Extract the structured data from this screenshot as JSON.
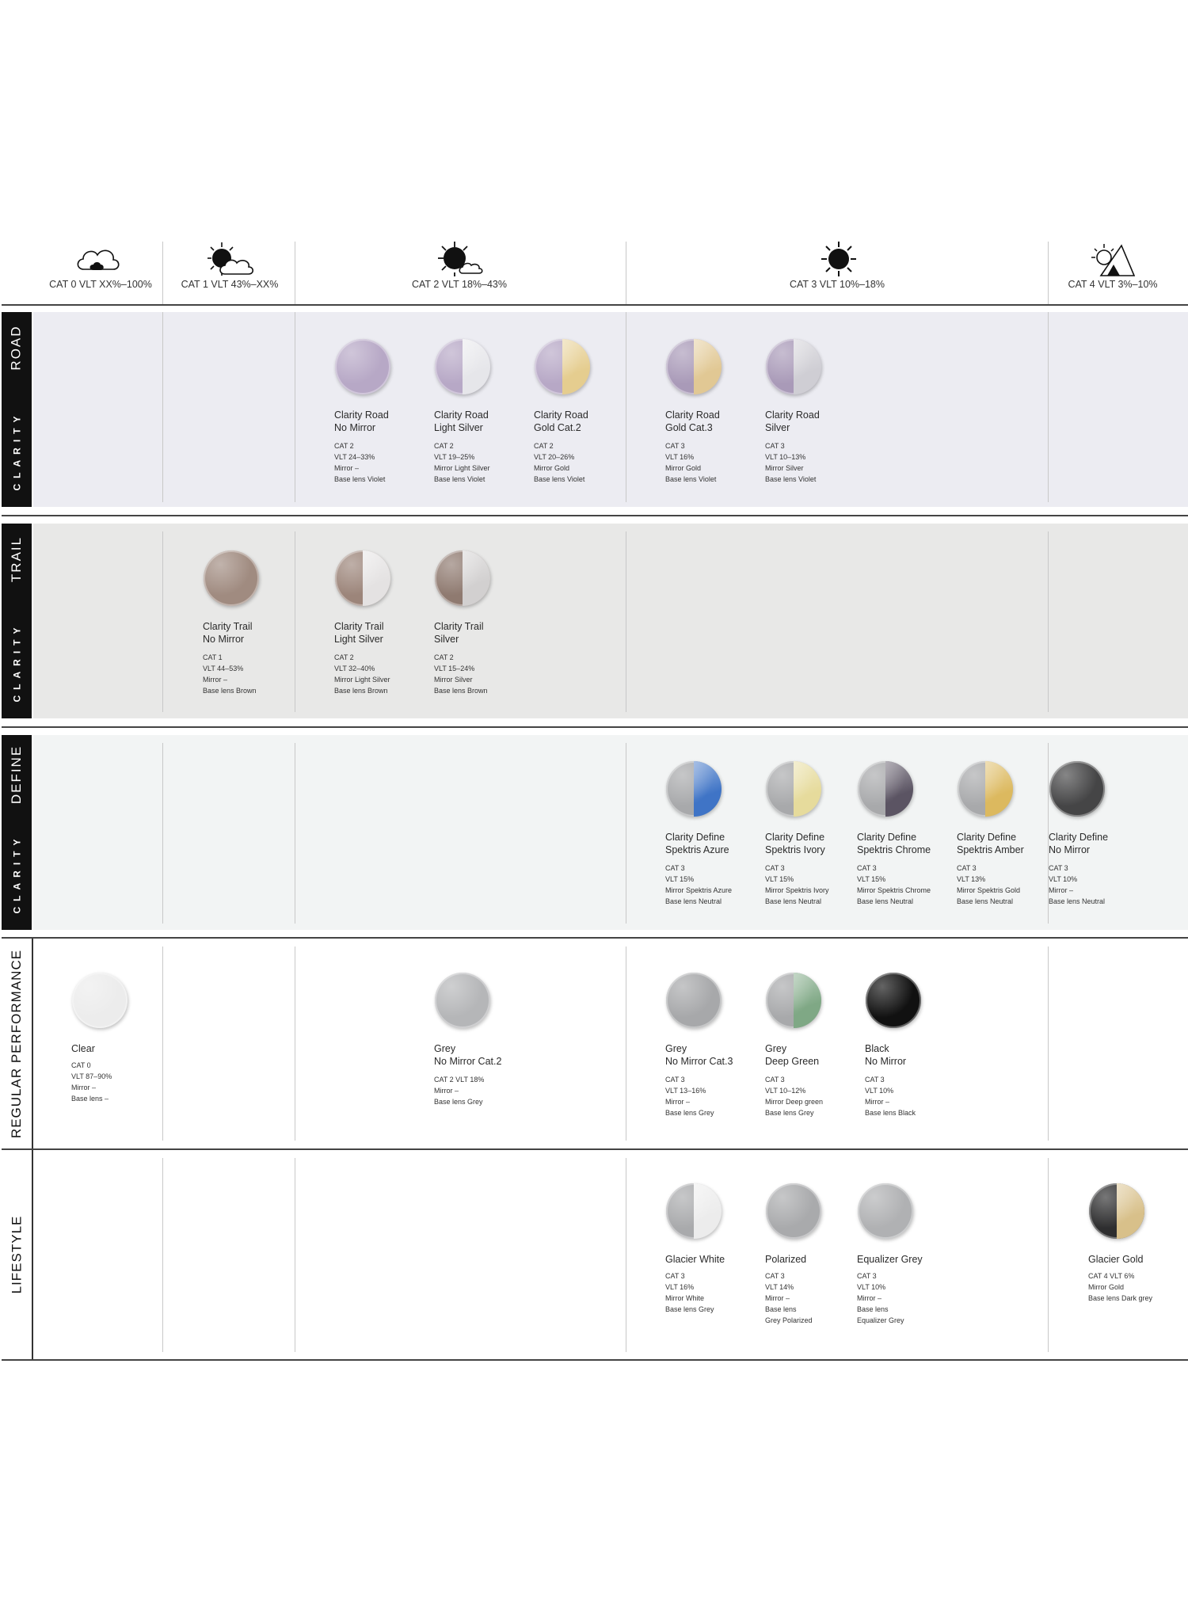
{
  "header": {
    "columns": [
      {
        "label": "CAT 0 VLT XX%–100%",
        "icon": "cloud-icon"
      },
      {
        "label": "CAT 1 VLT 43%–XX%",
        "icon": "sun-behind-cloud-icon"
      },
      {
        "label": "CAT 2 VLT 18%–43%",
        "icon": "partly-sunny-icon"
      },
      {
        "label": "CAT 3 VLT 10%–18%",
        "icon": "sun-icon"
      },
      {
        "label": "CAT 4 VLT 3%–10%",
        "icon": "mountain-sun-icon"
      }
    ]
  },
  "rows": {
    "clarity_road": {
      "label_top": "ROAD",
      "label_bottom": "CLARITY"
    },
    "clarity_trail": {
      "label_top": "TRAIL",
      "label_bottom": "CLARITY"
    },
    "clarity_define": {
      "label_top": "DEFINE",
      "label_bottom": "CLARITY"
    },
    "regular": {
      "label": "REGULAR PERFORMANCE"
    },
    "lifestyle": {
      "label": "LIFESTYLE"
    }
  },
  "lenses": [
    {
      "name1": "Clarity Road",
      "name2": "No Mirror",
      "specs": [
        "CAT 2",
        "VLT 24–33%",
        "Mirror –",
        "Base lens Violet"
      ],
      "base": "#b7a8c6",
      "mirror": "",
      "split": false
    },
    {
      "name1": "Clarity Road",
      "name2": "Light Silver",
      "specs": [
        "CAT 2",
        "VLT 19–25%",
        "Mirror Light Silver",
        "Base lens Violet"
      ],
      "base": "#b7a8c6",
      "mirror": "#e6e6ea",
      "split": true
    },
    {
      "name1": "Clarity Road",
      "name2": "Gold Cat.2",
      "specs": [
        "CAT 2",
        "VLT 20–26%",
        "Mirror Gold",
        "Base lens Violet"
      ],
      "base": "#b7a8c6",
      "mirror": "#e5cd8f",
      "split": true
    },
    {
      "name1": "Clarity Road",
      "name2": "Gold Cat.3",
      "specs": [
        "CAT 3",
        "VLT 16%",
        "Mirror Gold",
        "Base lens Violet"
      ],
      "base": "#a99ab8",
      "mirror": "#e1c894",
      "split": true
    },
    {
      "name1": "Clarity Road",
      "name2": "Silver",
      "specs": [
        "CAT 3",
        "VLT 10–13%",
        "Mirror Silver",
        "Base lens Violet"
      ],
      "base": "#a99ab8",
      "mirror": "#cfced4",
      "split": true
    },
    {
      "name1": "Clarity Trail",
      "name2": "No Mirror",
      "specs": [
        "CAT 1",
        "VLT 44–53%",
        "Mirror –",
        "Base lens Brown"
      ],
      "base": "#a08b80",
      "mirror": "",
      "split": false
    },
    {
      "name1": "Clarity Trail",
      "name2": "Light Silver",
      "specs": [
        "CAT 2",
        "VLT 32–40%",
        "Mirror Light Silver",
        "Base lens Brown"
      ],
      "base": "#9c857a",
      "mirror": "#e4e2e2",
      "split": true
    },
    {
      "name1": "Clarity Trail",
      "name2": "Silver",
      "specs": [
        "CAT 2",
        "VLT 15–24%",
        "Mirror Silver",
        "Base lens Brown"
      ],
      "base": "#8f7a70",
      "mirror": "#d2d0d0",
      "split": true
    },
    {
      "name1": "Clarity Define",
      "name2": "Spektris Azure",
      "specs": [
        "CAT 3",
        "VLT 15%",
        "Mirror Spektris Azure",
        "Base lens Neutral"
      ],
      "base": "#a8a9ab",
      "mirror": "#3f74c6",
      "split": true
    },
    {
      "name1": "Clarity Define",
      "name2": "Spektris Ivory",
      "specs": [
        "CAT 3",
        "VLT 15%",
        "Mirror Spektris Ivory",
        "Base lens Neutral"
      ],
      "base": "#a8a9ab",
      "mirror": "#e6db9c",
      "split": true
    },
    {
      "name1": "Clarity Define",
      "name2": "Spektris Chrome",
      "specs": [
        "CAT 3",
        "VLT 15%",
        "Mirror Spektris Chrome",
        "Base lens Neutral"
      ],
      "base": "#a8a9ab",
      "mirror": "#5b5463",
      "split": true
    },
    {
      "name1": "Clarity Define",
      "name2": "Spektris Amber",
      "specs": [
        "CAT 3",
        "VLT 13%",
        "Mirror Spektris Gold",
        "Base lens Neutral"
      ],
      "base": "#a8a9ab",
      "mirror": "#dcb95f",
      "split": true
    },
    {
      "name1": "Clarity Define",
      "name2": "No Mirror",
      "specs": [
        "CAT 3",
        "VLT 10%",
        "Mirror –",
        "Base lens Neutral"
      ],
      "base": "#454546",
      "mirror": "",
      "split": false
    },
    {
      "name1": "Clear",
      "name2": "",
      "specs": [
        "CAT 0",
        "VLT 87–90%",
        "Mirror –",
        "Base lens –"
      ],
      "base": "#ececec",
      "mirror": "",
      "split": false
    },
    {
      "name1": "Grey",
      "name2": "No Mirror Cat.2",
      "specs": [
        "CAT 2  VLT 18%",
        "Mirror –",
        "Base lens Grey"
      ],
      "base": "#b5b6b8",
      "mirror": "",
      "split": false
    },
    {
      "name1": "Grey",
      "name2": "No Mirror Cat.3",
      "specs": [
        "CAT 3",
        "VLT 13–16%",
        "Mirror –",
        "Base lens Grey"
      ],
      "base": "#a7a8aa",
      "mirror": "",
      "split": false
    },
    {
      "name1": "Grey",
      "name2": "Deep Green",
      "specs": [
        "CAT 3",
        "VLT 10–12%",
        "Mirror Deep green",
        "Base lens Grey"
      ],
      "base": "#a8a9ab",
      "mirror": "#7fa885",
      "split": true
    },
    {
      "name1": "Black",
      "name2": "No Mirror",
      "specs": [
        "CAT 3",
        "VLT 10%",
        "Mirror –",
        "Base lens Black"
      ],
      "base": "#111111",
      "mirror": "",
      "split": false
    },
    {
      "name1": "Glacier White",
      "name2": "",
      "specs": [
        "CAT 3",
        "VLT 16%",
        "Mirror White",
        "Base lens Grey"
      ],
      "base": "#a9aaac",
      "mirror": "#ececec",
      "split": true
    },
    {
      "name1": "Polarized",
      "name2": "",
      "specs": [
        "CAT 3",
        "VLT 14%",
        "Mirror –",
        "Base lens",
        "Grey Polarized"
      ],
      "base": "#a9aaac",
      "mirror": "",
      "split": false
    },
    {
      "name1": "Equalizer Grey",
      "name2": "",
      "specs": [
        "CAT 3",
        "VLT 10%",
        "Mirror –",
        "Base lens",
        "Equalizer Grey"
      ],
      "base": "#b0b1b3",
      "mirror": "",
      "split": false
    },
    {
      "name1": "Glacier Gold",
      "name2": "",
      "specs": [
        "CAT 4  VLT 6%",
        "Mirror Gold",
        "Base lens Dark grey"
      ],
      "base": "#2e2e2f",
      "mirror": "#d8c08a",
      "split": true
    }
  ]
}
